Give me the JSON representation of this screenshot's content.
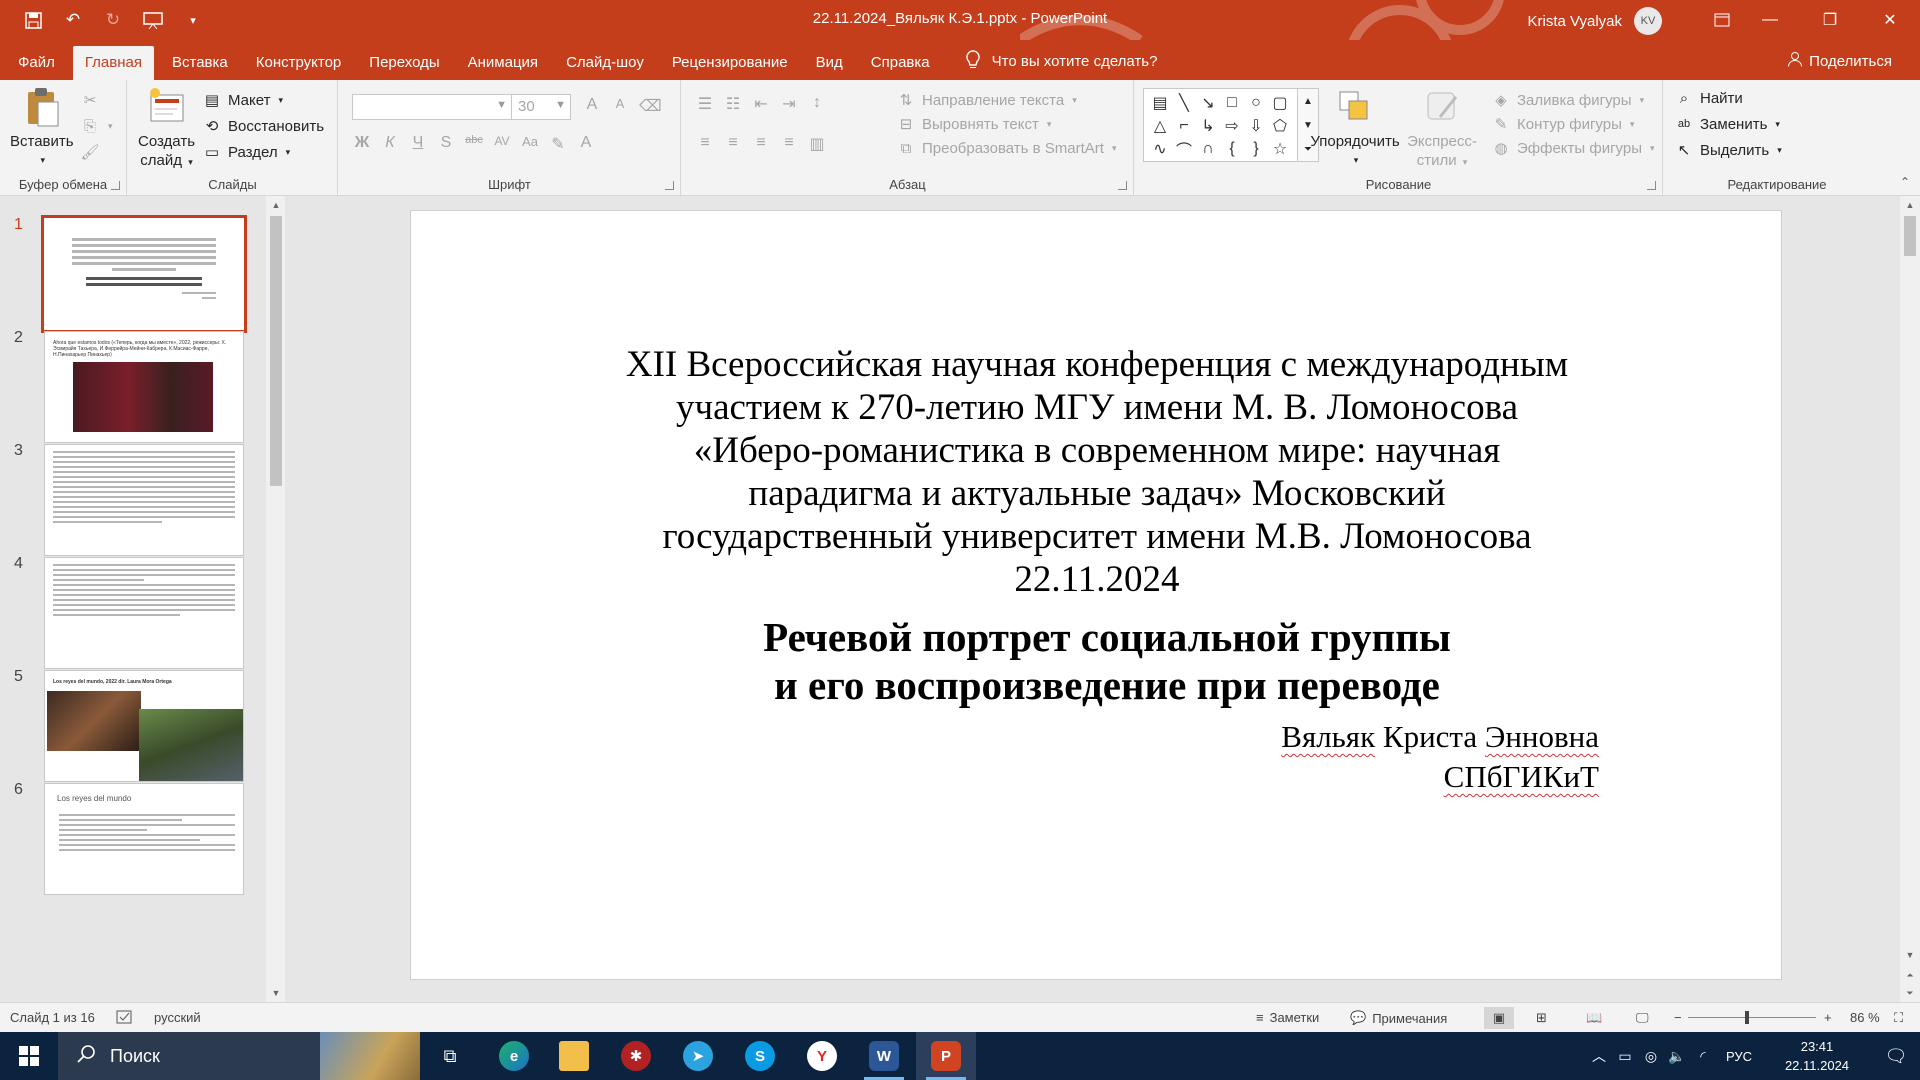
{
  "titlebar": {
    "document_title": "22.11.2024_Вяльяк К.Э.1.pptx  -  PowerPoint",
    "user_name": "Krista Vyalyak",
    "avatar_initials": "KV"
  },
  "tabs": [
    "Файл",
    "Главная",
    "Вставка",
    "Конструктор",
    "Переходы",
    "Анимация",
    "Слайд-шоу",
    "Рецензирование",
    "Вид",
    "Справка"
  ],
  "active_tab": "Главная",
  "tell_me": "Что вы хотите сделать?",
  "share": "Поделиться",
  "ribbon": {
    "clipboard": {
      "label": "Буфер обмена",
      "paste": "Вставить"
    },
    "slides": {
      "label": "Слайды",
      "new_slide_line1": "Создать",
      "new_slide_line2": "слайд",
      "layout": "Макет",
      "reset": "Восстановить",
      "section": "Раздел"
    },
    "font": {
      "label": "Шрифт",
      "font_size": "30"
    },
    "paragraph": {
      "label": "Абзац",
      "text_direction": "Направление текста",
      "align_text": "Выровнять текст",
      "smartart": "Преобразовать в SmartArt"
    },
    "drawing": {
      "label": "Рисование",
      "arrange": "Упорядочить",
      "quick_styles_line1": "Экспресс-",
      "quick_styles_line2": "стили",
      "shape_fill": "Заливка фигуры",
      "shape_outline": "Контур фигуры",
      "shape_effects": "Эффекты фигуры"
    },
    "editing": {
      "label": "Редактирование",
      "find": "Найти",
      "replace": "Заменить",
      "select": "Выделить"
    }
  },
  "thumbnails": {
    "numbers": [
      "1",
      "2",
      "3",
      "4",
      "5",
      "6"
    ],
    "slide2_caption": "Ahora que estamos todos («Теперь, когда мы вместе», 2022, режиссеры: Х. Эсмирайя Тахьера, И.Феррейра-Мейни-Кабрера, К.Масиас-Фарре, Н.Пинахарьер Пинахьер)",
    "slide5_caption": "Los reyes del mundo, 2022 dir. Laura Mora Ortega",
    "slide6_title": "Los reyes del mundo"
  },
  "slide": {
    "header_lines": [
      "XII Всероссийская научная конференция с международным",
      "участием к 270-летию МГУ имени М. В. Ломоносова",
      "«Иберо-романистика в современном мире: научная",
      "парадигма и актуальные задач» Московский",
      "государственный университет имени М.В. Ломоносова",
      "22.11.2024"
    ],
    "title_lines": [
      "Речевой портрет социальной группы",
      "и его воспроизведение при переводе"
    ],
    "author_first": "Вяльяк",
    "author_middle": " Криста ",
    "author_last": "Энновна",
    "institution": "СПбГИКиТ"
  },
  "statusbar": {
    "slide_counter": "Слайд 1 из 16",
    "language": "русский",
    "notes": "Заметки",
    "comments": "Примечания",
    "zoom": "86 %"
  },
  "taskbar": {
    "search_placeholder": "Поиск",
    "language": "РУС",
    "time": "23:41",
    "date": "22.11.2024"
  },
  "colors": {
    "accent": "#c43e1c",
    "ribbon_bg": "#f3f3f3",
    "workspace_bg": "#e6e6e6",
    "taskbar_bg": "#0c2340"
  }
}
